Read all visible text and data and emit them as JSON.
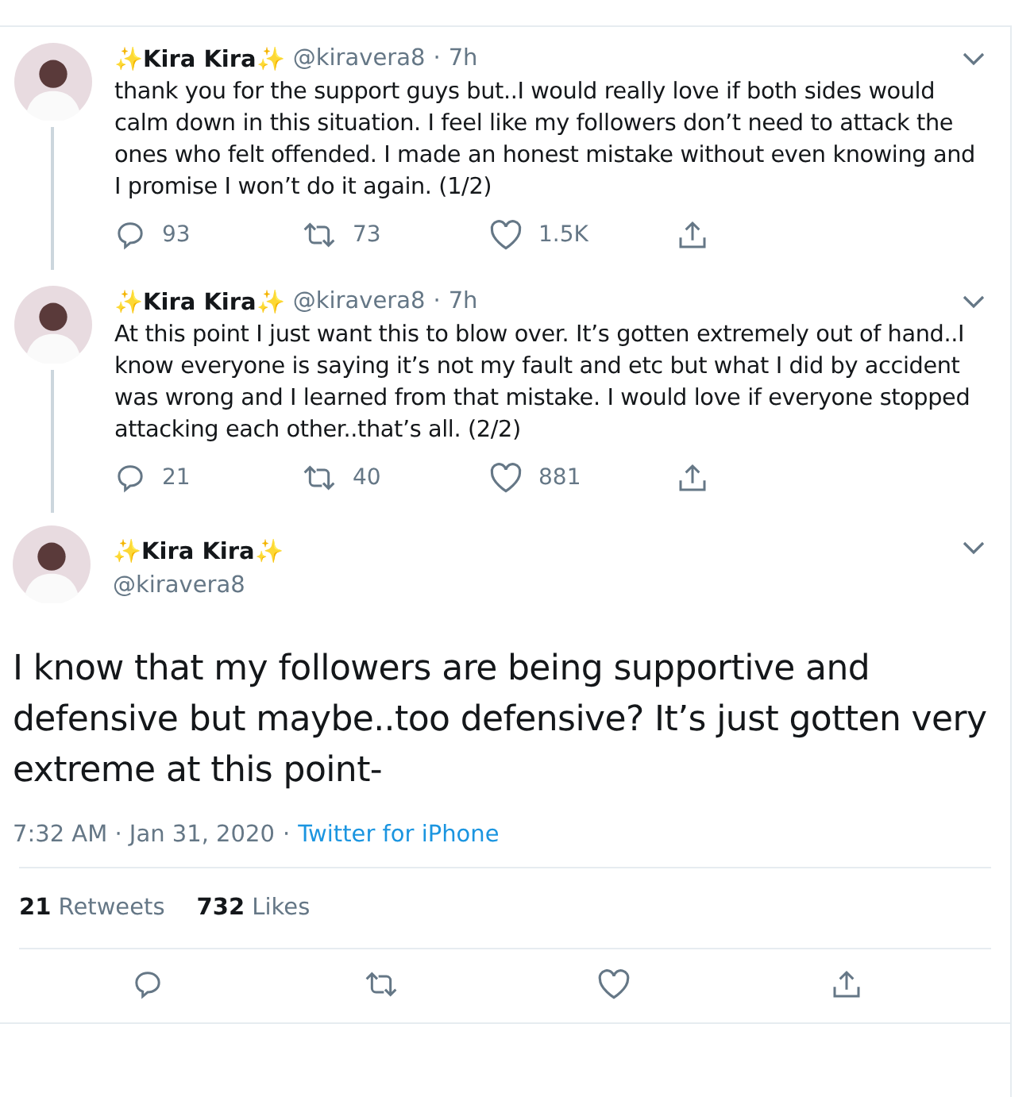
{
  "thread": [
    {
      "name": "✨Kira Kira✨",
      "handle": "@kiravera8",
      "dot": "·",
      "time": "7h",
      "text": "thank you for the support guys but..I would really love if both sides would calm down in this situation. I feel like my followers don’t need to attack the ones who felt offended. I made an honest mistake without even knowing and I promise I won’t do it again. (1/2)",
      "replies": "93",
      "retweets": "73",
      "likes": "1.5K"
    },
    {
      "name": "✨Kira Kira✨",
      "handle": "@kiravera8",
      "dot": "·",
      "time": "7h",
      "text": "At this point I just want this to blow over. It’s gotten extremely out of hand..I know everyone is saying it’s not my fault and etc but what I did by accident was wrong and I learned from that mistake. I would love if everyone stopped attacking each other..that’s all. (2/2)",
      "replies": "21",
      "retweets": "40",
      "likes": "881"
    }
  ],
  "main": {
    "name": "✨Kira Kira✨",
    "handle": "@kiravera8",
    "text": "I know that my followers are being supportive and defensive but maybe..too defensive? It’s just gotten very extreme at this point-",
    "timestamp": "7:32 AM · Jan 31, 2020",
    "dot": "·",
    "source": "Twitter for iPhone",
    "retweet_count": "21",
    "retweet_label": "Retweets",
    "like_count": "732",
    "like_label": "Likes"
  }
}
